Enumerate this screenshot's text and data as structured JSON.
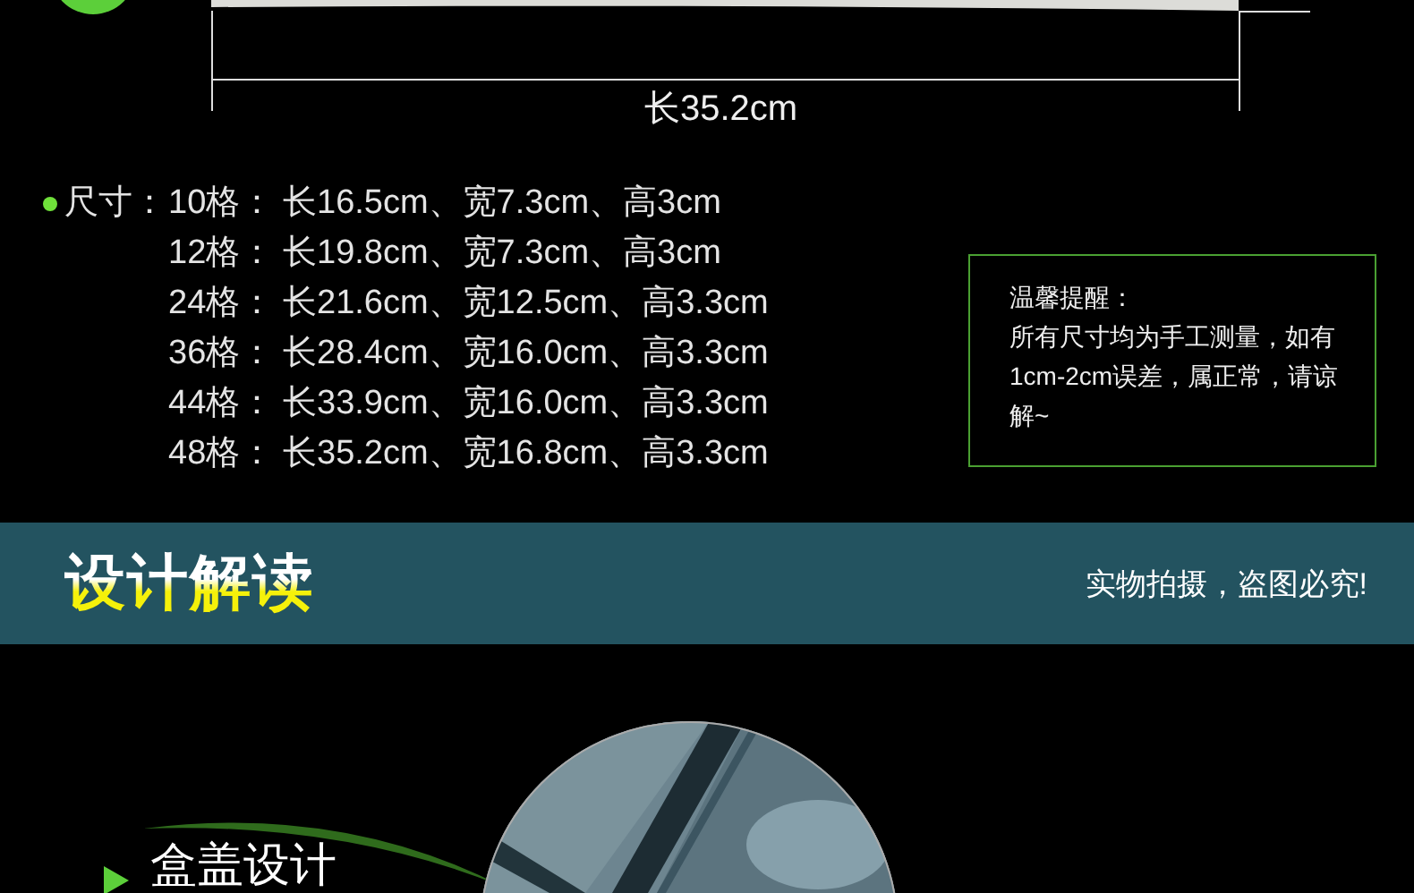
{
  "dimension": {
    "label": "长35.2cm"
  },
  "specs": {
    "label": "尺寸：",
    "rows": [
      {
        "count": "10格：",
        "text": "长16.5cm、宽7.3cm、高3cm"
      },
      {
        "count": "12格：",
        "text": "长19.8cm、宽7.3cm、高3cm"
      },
      {
        "count": "24格：",
        "text": "长21.6cm、宽12.5cm、高3.3cm"
      },
      {
        "count": "36格：",
        "text": "长28.4cm、宽16.0cm、高3.3cm"
      },
      {
        "count": "44格：",
        "text": "长33.9cm、宽16.0cm、高3.3cm"
      },
      {
        "count": "48格：",
        "text": "长35.2cm、宽16.8cm、高3.3cm"
      }
    ]
  },
  "notice": {
    "title": "温馨提醒：",
    "body": "所有尺寸均为手工测量，如有1cm-2cm误差，属正常，请谅解~"
  },
  "banner": {
    "title": "设计解读",
    "note": "实物拍摄，盗图必究!"
  },
  "feature": {
    "heading": "盒盖设计"
  }
}
